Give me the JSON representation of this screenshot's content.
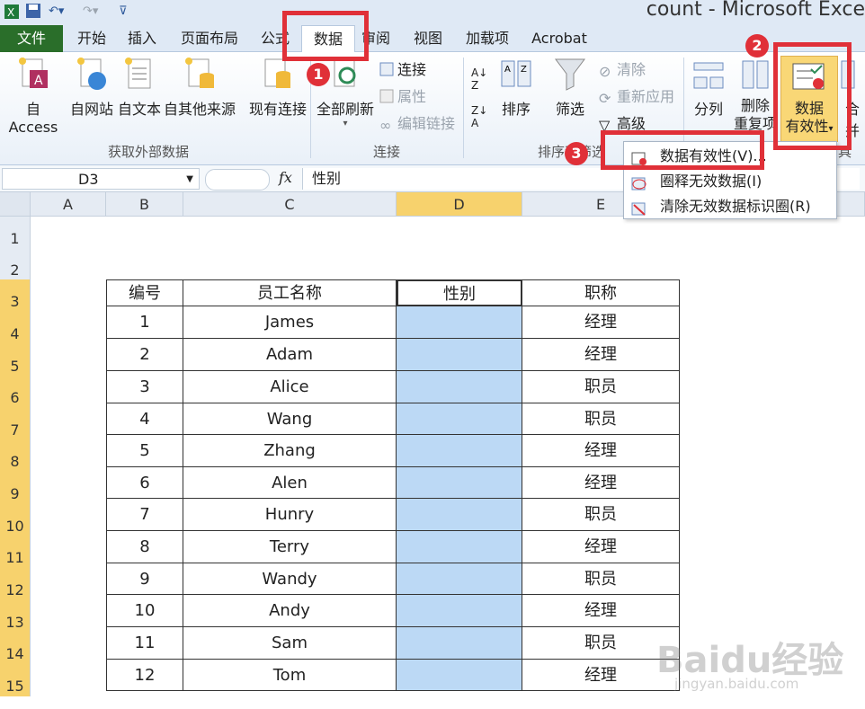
{
  "window": {
    "title": "count - Microsoft Exce"
  },
  "ribbon_tabs": [
    {
      "label": "文件"
    },
    {
      "label": "开始"
    },
    {
      "label": "插入"
    },
    {
      "label": "页面布局"
    },
    {
      "label": "公式"
    },
    {
      "label": "数据"
    },
    {
      "label": "审阅"
    },
    {
      "label": "视图"
    },
    {
      "label": "加载项"
    },
    {
      "label": "Acrobat"
    }
  ],
  "ribbon": {
    "get_external": {
      "group_label": "获取外部数据",
      "from_access": "自 Access",
      "from_web": "自网站",
      "from_text": "自文本",
      "from_other": "自其他来源",
      "existing_conn": "现有连接"
    },
    "connections": {
      "group_label": "连接",
      "refresh_all": "全部刷新",
      "connections": "连接",
      "properties": "属性",
      "edit_links": "编辑链接"
    },
    "sort_filter": {
      "group_label": "排序和筛选",
      "sort": "排序",
      "filter": "筛选",
      "clear": "清除",
      "reapply": "重新应用",
      "advanced": "高级"
    },
    "data_tools": {
      "group_label": "具",
      "text_to_columns": "分列",
      "remove_dup_1": "删除",
      "remove_dup_2": "重复项",
      "validation_1": "数据",
      "validation_2": "有效性",
      "consolidate": "合并"
    }
  },
  "formula_bar": {
    "cell_ref": "D3",
    "fx": "fx",
    "value": "性别"
  },
  "columns": [
    "A",
    "B",
    "C",
    "D",
    "E"
  ],
  "rows": [
    "1",
    "2",
    "3",
    "4",
    "5",
    "6",
    "7",
    "8",
    "9",
    "10",
    "11",
    "12",
    "13",
    "14",
    "15"
  ],
  "table": {
    "headers": [
      "编号",
      "员工名称",
      "性别",
      "职称"
    ],
    "rows": [
      [
        "1",
        "James",
        "",
        "经理"
      ],
      [
        "2",
        "Adam",
        "",
        "经理"
      ],
      [
        "3",
        "Alice",
        "",
        "职员"
      ],
      [
        "4",
        "Wang",
        "",
        "职员"
      ],
      [
        "5",
        "Zhang",
        "",
        "经理"
      ],
      [
        "6",
        "Alen",
        "",
        "经理"
      ],
      [
        "7",
        "Hunry",
        "",
        "职员"
      ],
      [
        "8",
        "Terry",
        "",
        "经理"
      ],
      [
        "9",
        "Wandy",
        "",
        "职员"
      ],
      [
        "10",
        "Andy",
        "",
        "经理"
      ],
      [
        "11",
        "Sam",
        "",
        "职员"
      ],
      [
        "12",
        "Tom",
        "",
        "经理"
      ]
    ]
  },
  "dropdown": {
    "items": [
      {
        "label": "数据有效性(V)..."
      },
      {
        "label": "圈释无效数据(I)"
      },
      {
        "label": "清除无效数据标识圈(R)"
      }
    ]
  },
  "annotations": {
    "badges": [
      "1",
      "2",
      "3"
    ]
  },
  "watermark": {
    "brand": "Baidu经验",
    "url": "jingyan.baidu.com"
  },
  "colors": {
    "accent_red": "#e03038",
    "selection_blue": "#bcd9f5",
    "header_highlight": "#f7d26d",
    "file_tab_green": "#2a6e2a"
  }
}
